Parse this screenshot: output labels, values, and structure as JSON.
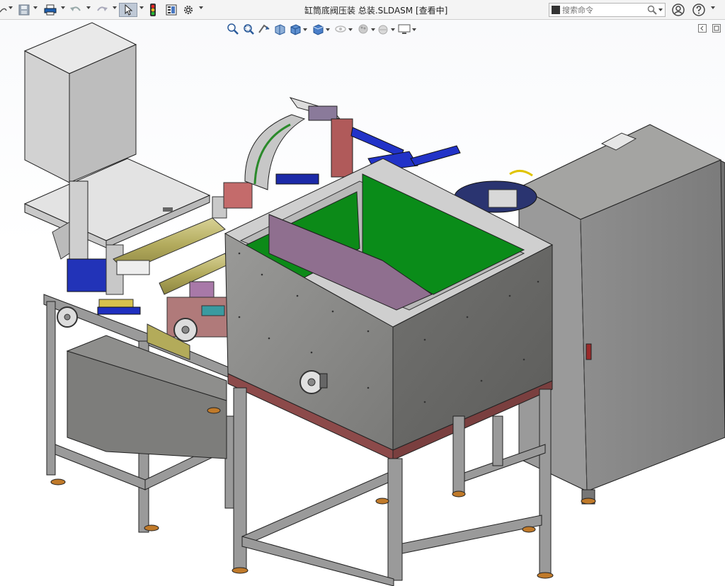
{
  "window": {
    "title": "缸筒底阀压装 总装.SLDASM [查看中]"
  },
  "search": {
    "placeholder": "搜索命令"
  },
  "toolbar": {
    "items": [
      "undo",
      "save",
      "print",
      "undo-arrow",
      "redo",
      "select",
      "rebuild",
      "file-properties",
      "options"
    ]
  },
  "heads_up_toolbar": {
    "items": [
      "zoom-to-fit",
      "zoom-to-area",
      "previous-view",
      "section-view",
      "view-orientation",
      "display-style",
      "hide-show-items",
      "edit-appearance",
      "apply-scene",
      "view-settings"
    ]
  },
  "colors": {
    "frame_gray": "#8f8f8f",
    "panel_gray": "#8a8a88",
    "green": "#0b8a1a",
    "purple": "#8e6f8e",
    "blue": "#1830c8",
    "olive": "#b9b26a",
    "cabinet_gray": "#939393"
  }
}
